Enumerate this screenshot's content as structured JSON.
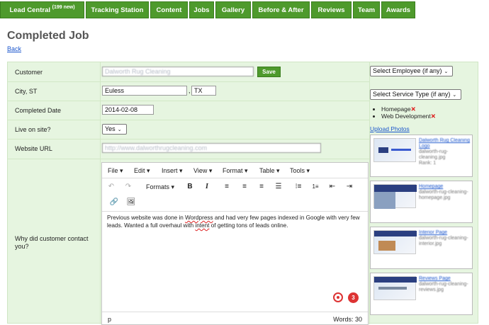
{
  "nav": {
    "tabs": [
      {
        "label": "Lead Central",
        "badge": "(199 new)"
      },
      {
        "label": "Tracking Station"
      },
      {
        "label": "Content"
      },
      {
        "label": "Jobs"
      },
      {
        "label": "Gallery"
      },
      {
        "label": "Before & After"
      },
      {
        "label": "Reviews"
      },
      {
        "label": "Team"
      },
      {
        "label": "Awards"
      }
    ]
  },
  "page": {
    "title": "Completed Job",
    "back_label": "Back"
  },
  "form": {
    "customer": {
      "label": "Customer",
      "value": "Dalworth Rug Cleaning",
      "save_label": "Save"
    },
    "city": {
      "label": "City, ST",
      "city_value": "Euless",
      "separator": ",",
      "state_value": "TX"
    },
    "completed_date": {
      "label": "Completed Date",
      "value": "2014-02-08"
    },
    "live": {
      "label": "Live on site?",
      "value": "Yes"
    },
    "website": {
      "label": "Website URL",
      "value": "http://www.dalworthrugcleaning.com"
    },
    "why": {
      "label": "Why did customer contact you?"
    }
  },
  "editor": {
    "menus": [
      "File",
      "Edit",
      "Insert",
      "View",
      "Format",
      "Table",
      "Tools"
    ],
    "formats_label": "Formats",
    "content_before": "Previous website was done in ",
    "spell_1": "Wordpress",
    "content_mid": " and had very few pages indexed in Google with very few leads. Wanted a full overhaul with ",
    "spell_2": "intent",
    "content_after": " of getting tons of leads online.",
    "status_path": "p",
    "words": "Words: 30",
    "grammar_count": "3"
  },
  "side": {
    "employee_select": "Select Employee (if any)",
    "service_select": "Select Service Type (if any)",
    "services": [
      "Homepage",
      "Web Development"
    ],
    "upload_label": "Upload Photos",
    "photos": [
      {
        "title": "Dalworth Rug Cleaning Logo",
        "file": "dalworth-rug-cleaning.jpg",
        "rank": "Rank: 1"
      },
      {
        "title": "Homepage",
        "file": "dalworth-rug-cleaning-homepage.jpg",
        "rank": ""
      },
      {
        "title": "Interior Page",
        "file": "dalworth-rug-cleaning-interior.jpg",
        "rank": ""
      },
      {
        "title": "Reviews Page",
        "file": "dalworth-rug-cleaning-reviews.jpg",
        "rank": ""
      }
    ]
  },
  "colors": {
    "nav_green": "#4e9a2c",
    "form_bg": "#e6f5e0",
    "link_blue": "#1a55cc",
    "remove_red": "#d11111"
  }
}
